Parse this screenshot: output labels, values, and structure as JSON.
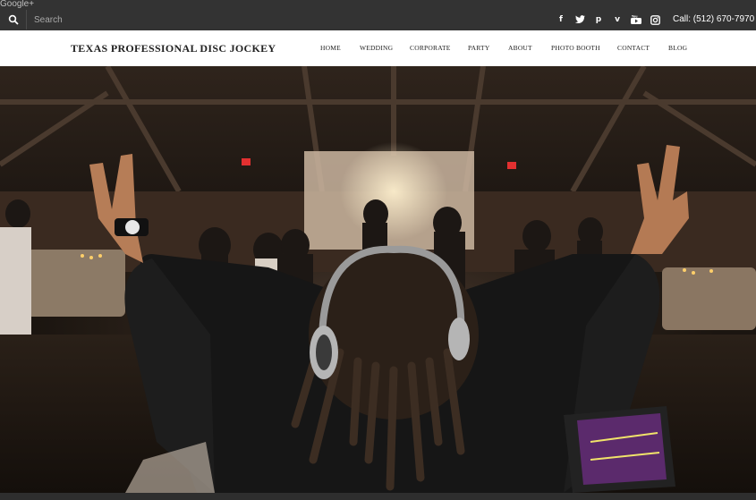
{
  "gplus_label": "Google+",
  "topbar": {
    "search_placeholder": "Search",
    "social_icons": [
      "facebook-icon",
      "twitter-icon",
      "pinterest-icon",
      "vimeo-icon",
      "youtube-icon",
      "instagram-icon"
    ],
    "call_text": "Call:  (512) 670-7970"
  },
  "navbar": {
    "logo": "TEXAS PROFESSIONAL DISC JOCKEY",
    "items": [
      "HOME",
      "WEDDING",
      "CORPORATE",
      "PARTY",
      "ABOUT",
      "PHOTO BOOTH",
      "CONTACT",
      "BLOG"
    ]
  },
  "colors": {
    "topbar": "#333333",
    "navbar": "#ffffff",
    "logo_text": "#222222"
  }
}
